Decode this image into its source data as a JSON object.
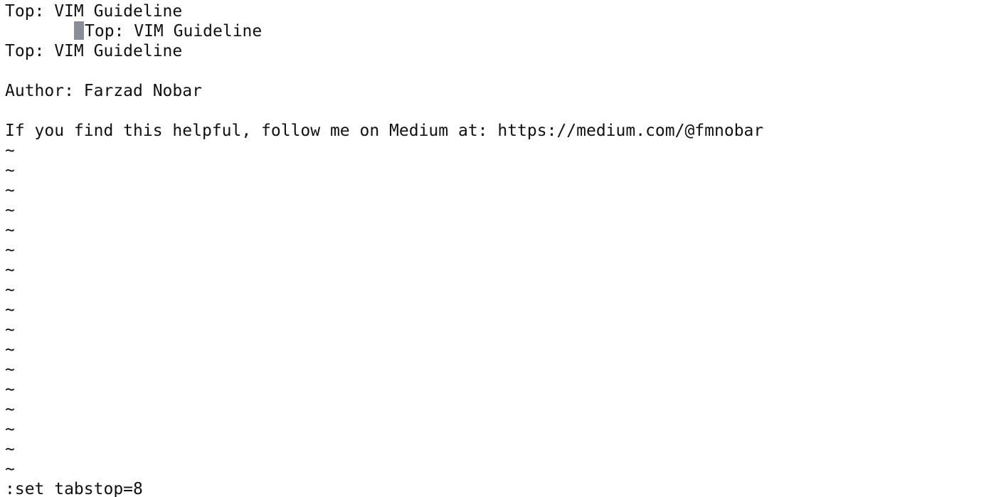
{
  "buffer": {
    "lines": [
      "Top: VIM Guideline",
      "Top: VIM Guideline",
      "Top: VIM Guideline",
      "",
      "Author: Farzad Nobar",
      "",
      "If you find this helpful, follow me on Medium at: https://medium.com/@fmnobar"
    ],
    "empty_line_marker": "~"
  },
  "command_line": ":set tabstop=8",
  "colors": {
    "background": "#ffffff",
    "text": "#111111",
    "cursor": "#8a8d96"
  }
}
